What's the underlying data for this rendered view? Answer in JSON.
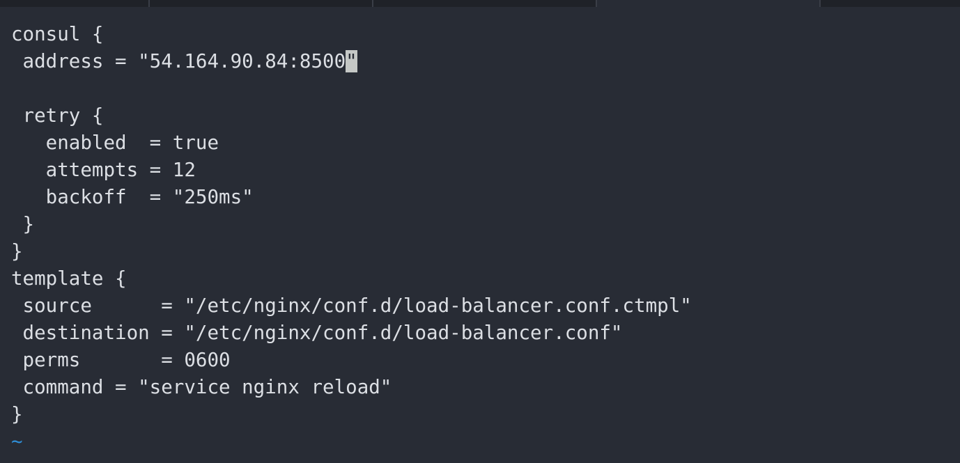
{
  "editor": {
    "lines": [
      "consul {",
      " address = \"54.164.90.84:8500\"",
      "",
      " retry {",
      "   enabled  = true",
      "   attempts = 12",
      "   backoff  = \"250ms\"",
      " }",
      "}",
      "template {",
      " source      = \"/etc/nginx/conf.d/load-balancer.conf.ctmpl\"",
      " destination = \"/etc/nginx/conf.d/load-balancer.conf\"",
      " perms       = 0600",
      " command = \"service nginx reload\"",
      "}"
    ],
    "cursor_line_prefix": " address = \"54.164.90.84:8500",
    "cursor_char": "\"",
    "empty_line_marker": "~"
  },
  "colors": {
    "background": "#282c35",
    "text": "#dcdfe4",
    "cursor": "#c5c8c6",
    "tilde": "#2f8fd8"
  }
}
